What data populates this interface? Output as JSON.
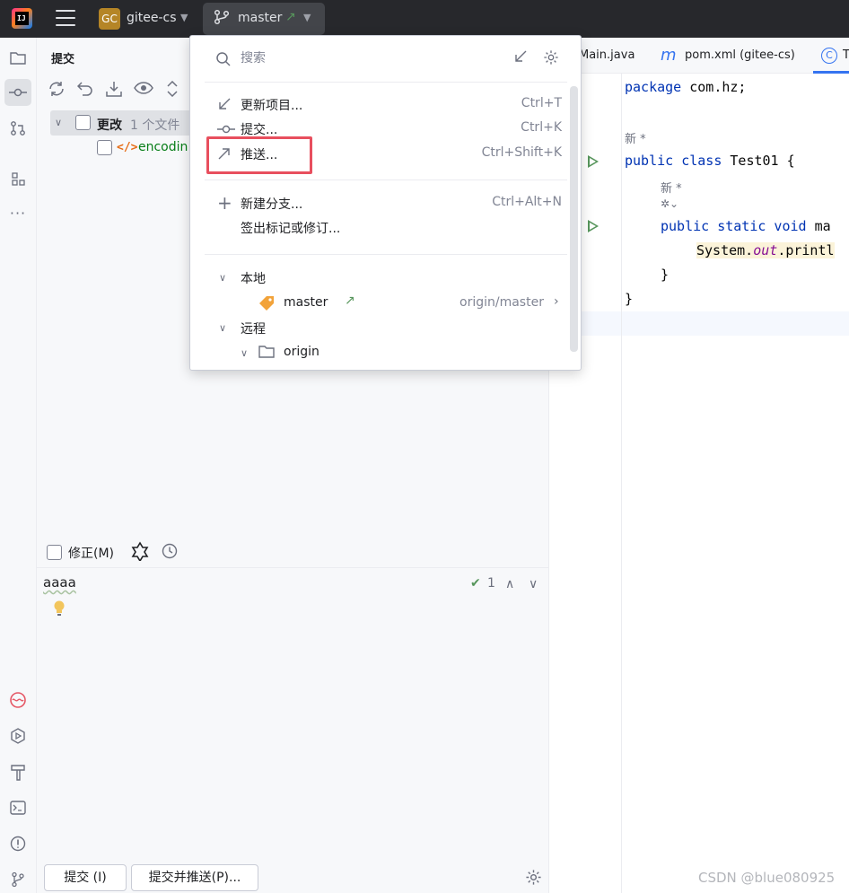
{
  "titlebar": {
    "project_badge": "GC",
    "project_name": "gitee-cs",
    "branch": "master"
  },
  "commit_panel": {
    "title": "提交",
    "changes_label": "更改",
    "changes_count": "1 个文件",
    "file_name": "encodin",
    "amend_label": "修正(M)",
    "message": "aaaa",
    "inspection_count": "1",
    "commit_button": "提交 (I)",
    "commit_push_button": "提交并推送(P)..."
  },
  "editor": {
    "tabs": [
      "Main.java",
      "pom.xml (gitee-cs)",
      "T"
    ],
    "code": {
      "line1_kw": "package",
      "line1_rest": " com.hz;",
      "hint_new": "新 *",
      "class_kw": "public class",
      "class_rest": " Test01 {",
      "hint_new2": "新 *",
      "method_kw": "public static void",
      "method_rest": " ma",
      "sys": "System.",
      "out": "out",
      "println": ".printl",
      "close_inner": "}",
      "close_outer": "}"
    }
  },
  "popup": {
    "search_placeholder": "搜索",
    "actions": [
      {
        "label": "更新项目...",
        "shortcut": "Ctrl+T"
      },
      {
        "label": "提交...",
        "shortcut": "Ctrl+K"
      },
      {
        "label": "推送...",
        "shortcut": "Ctrl+Shift+K"
      },
      {
        "label": "新建分支...",
        "shortcut": "Ctrl+Alt+N"
      },
      {
        "label": "签出标记或修订...",
        "shortcut": ""
      }
    ],
    "local_group": "本地",
    "local_branch": "master",
    "local_tracking": "origin/master",
    "remote_group": "远程",
    "remote_name": "origin"
  },
  "watermark": "CSDN @blue080925",
  "colors": {
    "titlebar": "#27282c",
    "accent": "#3574f0",
    "highlight_box": "#e84f5e",
    "keyword": "#0033b3",
    "run_green": "#57965c"
  }
}
